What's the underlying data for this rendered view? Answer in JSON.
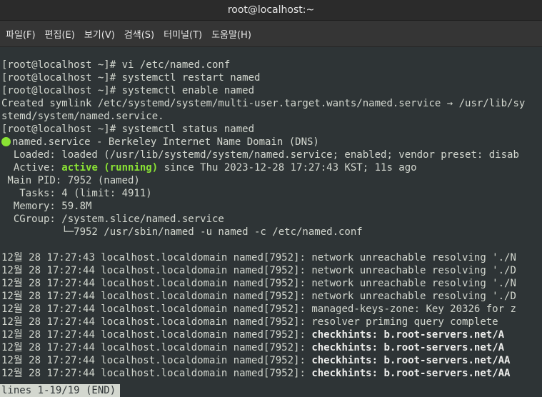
{
  "window": {
    "title": "root@localhost:~"
  },
  "menu": [
    "파일(F)",
    "편집(E)",
    "보기(V)",
    "검색(S)",
    "터미널(T)",
    "도움말(H)"
  ],
  "terminal": {
    "lines": [
      {
        "text": "[root@localhost ~]# vi /etc/named.conf"
      },
      {
        "text": "[root@localhost ~]# systemctl restart named"
      },
      {
        "text": "[root@localhost ~]# systemctl enable named"
      },
      {
        "text": "Created symlink /etc/systemd/system/multi-user.target.wants/named.service → /usr/lib/sy"
      },
      {
        "text": "stemd/system/named.service."
      },
      {
        "text": "[root@localhost ~]# systemctl status named"
      },
      {
        "dot": true,
        "text": "named.service - Berkeley Internet Name Domain (DNS)"
      },
      {
        "text": "  Loaded: loaded (/usr/lib/systemd/system/named.service; enabled; vendor preset: disab"
      },
      {
        "pre": "  Active: ",
        "highlight": "active (running)",
        "post": " since Thu 2023-12-28 17:27:43 KST; 11s ago"
      },
      {
        "text": " Main PID: 7952 (named)"
      },
      {
        "text": "   Tasks: 4 (limit: 4911)"
      },
      {
        "text": "  Memory: 59.8M"
      },
      {
        "text": "  CGroup: /system.slice/named.service"
      },
      {
        "text": "          └─7952 /usr/sbin/named -u named -c /etc/named.conf"
      },
      {
        "blank": true
      },
      {
        "text": "12월 28 17:27:43 localhost.localdomain named[7952]: network unreachable resolving './N"
      },
      {
        "text": "12월 28 17:27:44 localhost.localdomain named[7952]: network unreachable resolving './D"
      },
      {
        "text": "12월 28 17:27:44 localhost.localdomain named[7952]: network unreachable resolving './N"
      },
      {
        "text": "12월 28 17:27:44 localhost.localdomain named[7952]: network unreachable resolving './D"
      },
      {
        "text": "12월 28 17:27:44 localhost.localdomain named[7952]: managed-keys-zone: Key 20326 for z"
      },
      {
        "text": "12월 28 17:27:44 localhost.localdomain named[7952]: resolver priming query complete"
      },
      {
        "pre": "12월 28 17:27:44 localhost.localdomain named[7952]: ",
        "bold": "checkhints: b.root-servers.net/A"
      },
      {
        "pre": "12월 28 17:27:44 localhost.localdomain named[7952]: ",
        "bold": "checkhints: b.root-servers.net/A"
      },
      {
        "pre": "12월 28 17:27:44 localhost.localdomain named[7952]: ",
        "bold": "checkhints: b.root-servers.net/AA"
      },
      {
        "pre": "12월 28 17:27:44 localhost.localdomain named[7952]: ",
        "bold": "checkhints: b.root-servers.net/AA"
      }
    ],
    "status": "lines 1-19/19 (END)"
  }
}
